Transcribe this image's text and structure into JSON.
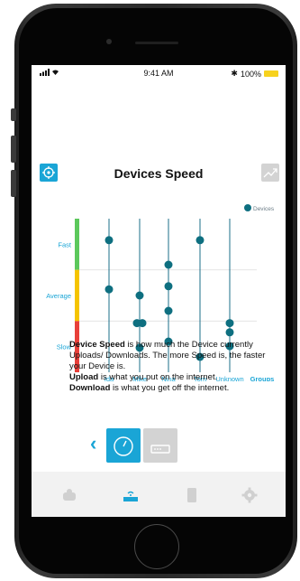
{
  "status": {
    "time": "9:41 AM",
    "battery": "100%"
  },
  "header": {
    "title": "Devices Speed"
  },
  "chart_data": {
    "type": "scatter",
    "categories": [
      "Ida",
      "Mike",
      "Nina",
      "Tom",
      "Unknown"
    ],
    "x_axis_title": "Groups",
    "y_levels": [
      "Fast",
      "Average",
      "Slow"
    ],
    "legend": "Devices",
    "level_colors": {
      "Fast": "#5cc85c",
      "Average": "#f5c400",
      "Slow": "#e8403a"
    },
    "series": [
      {
        "name": "Devices",
        "points": [
          {
            "category": "Ida",
            "values": [
              0.86,
              0.54
            ]
          },
          {
            "category": "Mike",
            "values": [
              0.5,
              0.32,
              0.16,
              0.32
            ]
          },
          {
            "category": "Nina",
            "values": [
              0.7,
              0.4,
              0.2,
              0.56
            ]
          },
          {
            "category": "Tom",
            "values": [
              0.86,
              0.1
            ]
          },
          {
            "category": "Unknown",
            "values": [
              0.32,
              0.26,
              0.17
            ]
          }
        ]
      }
    ]
  },
  "description": {
    "line1_bold": "Device Speed",
    "line1_rest": " is how much the Device currently Uploads/ Downloads. The more Speed is, the faster your Device is.",
    "upload_bold": "Upload",
    "upload_rest": " is what you put on the internet.",
    "download_bold": "Download",
    "download_rest": " is what you get off the internet."
  },
  "colors": {
    "accent": "#1aa5d6",
    "series": "#0e6f80",
    "grid": "#1b6f8a"
  },
  "icons": {
    "locate": "locate-icon",
    "trend": "trend-chart-icon",
    "speed": "speedometer-icon",
    "router": "router-icon",
    "back": "chevron-left-icon",
    "tabs": [
      "devices-tab-icon",
      "router-tab-icon",
      "phone-tab-icon",
      "settings-gear-icon"
    ]
  }
}
